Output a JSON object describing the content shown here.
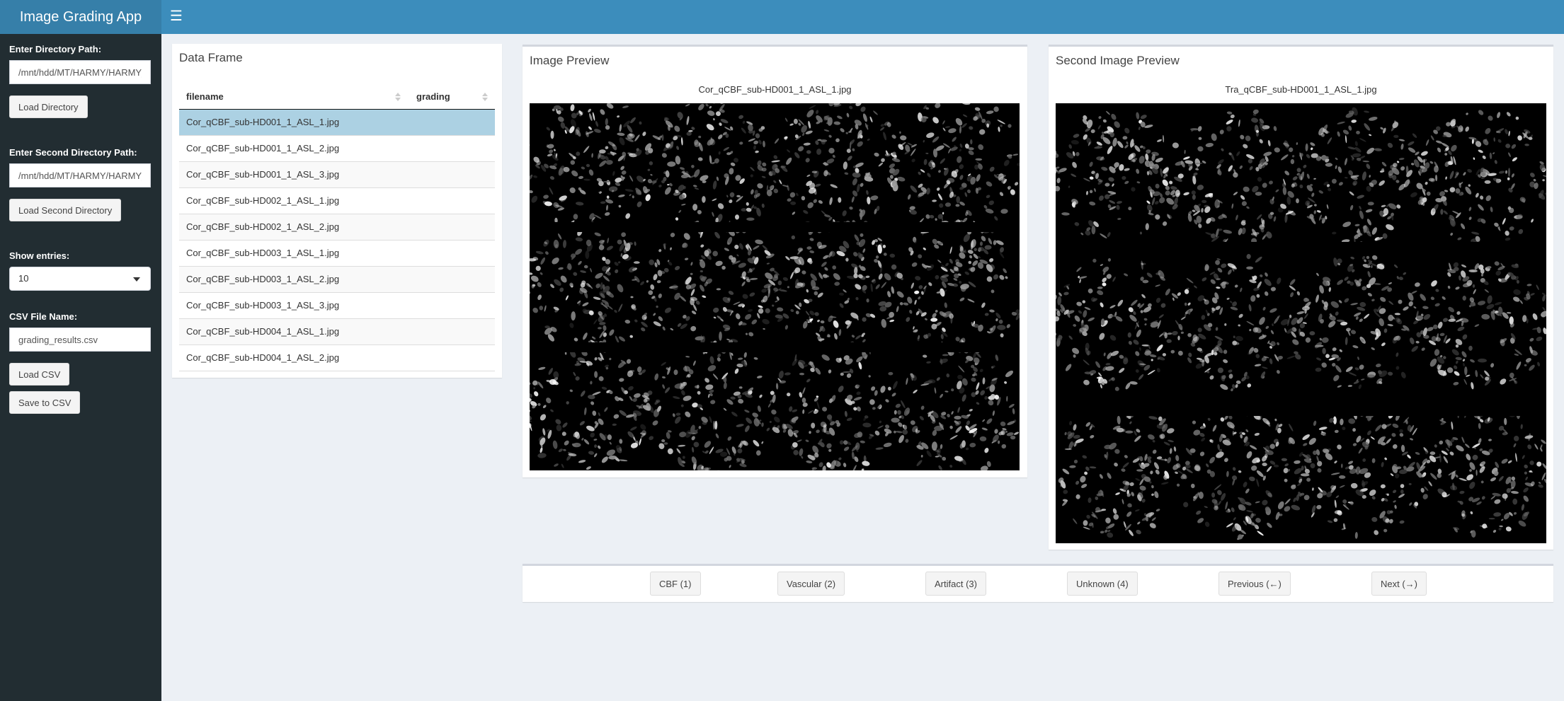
{
  "app": {
    "title": "Image Grading App",
    "menu_icon": "hamburger-icon",
    "header_color": "#3c8dbc",
    "sidebar_color": "#222d32"
  },
  "sidebar": {
    "dir_label": "Enter Directory Path:",
    "dir_value": "/mnt/hdd/MT/HARMY/HARMY_",
    "load_dir_button": "Load Directory",
    "second_dir_label": "Enter Second Directory Path:",
    "second_dir_value": "/mnt/hdd/MT/HARMY/HARMY_",
    "load_second_dir_button": "Load Second Directory",
    "entries_label": "Show entries:",
    "entries_value": "10",
    "csv_label": "CSV File Name:",
    "csv_value": "grading_results.csv",
    "load_csv_button": "Load CSV",
    "save_csv_button": "Save to CSV"
  },
  "data_frame": {
    "title": "Data Frame",
    "columns": [
      "filename",
      "grading"
    ],
    "rows": [
      {
        "filename": "Cor_qCBF_sub-HD001_1_ASL_1.jpg",
        "grading": ""
      },
      {
        "filename": "Cor_qCBF_sub-HD001_1_ASL_2.jpg",
        "grading": ""
      },
      {
        "filename": "Cor_qCBF_sub-HD001_1_ASL_3.jpg",
        "grading": ""
      },
      {
        "filename": "Cor_qCBF_sub-HD002_1_ASL_1.jpg",
        "grading": ""
      },
      {
        "filename": "Cor_qCBF_sub-HD002_1_ASL_2.jpg",
        "grading": ""
      },
      {
        "filename": "Cor_qCBF_sub-HD003_1_ASL_1.jpg",
        "grading": ""
      },
      {
        "filename": "Cor_qCBF_sub-HD003_1_ASL_2.jpg",
        "grading": ""
      },
      {
        "filename": "Cor_qCBF_sub-HD003_1_ASL_3.jpg",
        "grading": ""
      },
      {
        "filename": "Cor_qCBF_sub-HD004_1_ASL_1.jpg",
        "grading": ""
      },
      {
        "filename": "Cor_qCBF_sub-HD004_1_ASL_2.jpg",
        "grading": ""
      }
    ],
    "selected_row": 0,
    "selected_color": "#acd1e3"
  },
  "preview": {
    "title": "Image Preview",
    "caption": "Cor_qCBF_sub-HD001_1_ASL_1.jpg"
  },
  "second_preview": {
    "title": "Second Image Preview",
    "caption": "Tra_qCBF_sub-HD001_1_ASL_1.jpg"
  },
  "grading_buttons": {
    "cbf": "CBF (1)",
    "vascular": "Vascular (2)",
    "artifact": "Artifact (3)",
    "unknown": "Unknown (4)",
    "previous": "Previous (←)",
    "next": "Next (→)"
  }
}
